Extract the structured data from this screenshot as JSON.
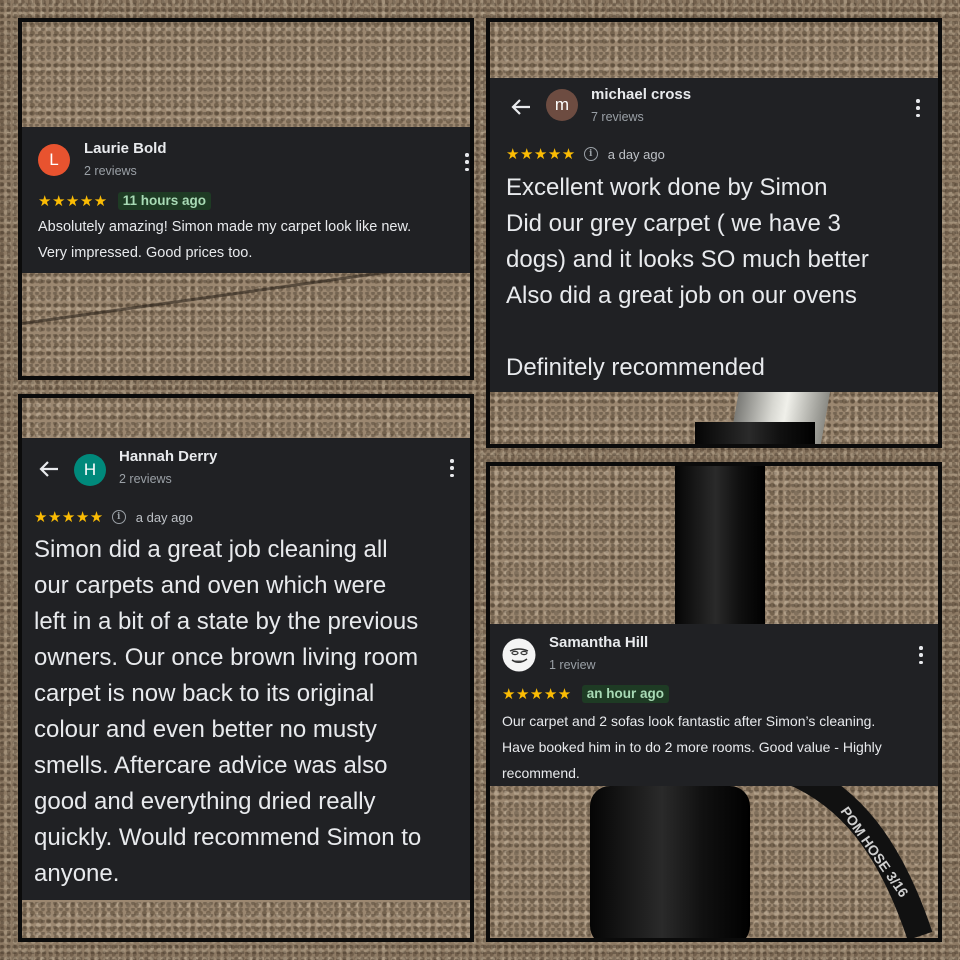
{
  "reviews": {
    "laurie": {
      "avatar_letter": "L",
      "avatar_color": "#e8532f",
      "name": "Laurie Bold",
      "review_count": "2 reviews",
      "stars": "★★★★★",
      "time": "11 hours ago",
      "text": "Absolutely amazing! Simon made my carpet look like new.\nVery impressed.  Good prices too."
    },
    "michael": {
      "avatar_letter": "m",
      "avatar_color": "#6d4c41",
      "name": "michael cross",
      "review_count": "7 reviews",
      "stars": "★★★★★",
      "time": "a day ago",
      "text": "Excellent work done by Simon\nDid our grey carpet ( we have 3\ndogs) and it looks SO much better\nAlso did a great job on our ovens\n\nDefinitely recommended"
    },
    "hannah": {
      "avatar_letter": "H",
      "avatar_color": "#00897b",
      "name": "Hannah Derry",
      "review_count": "2 reviews",
      "stars": "★★★★★",
      "time": "a day ago",
      "text": "Simon did a great job cleaning all\nour carpets and oven which were\nleft in a bit of a state by the previous\nowners. Our once brown living room\ncarpet is now back to its original\ncolour and even better no musty\nsmells. Aftercare advice was also\ngood and everything dried really\nquickly. Would recommend Simon to\nanyone."
    },
    "samantha": {
      "name": "Samantha Hill",
      "review_count": "1 review",
      "stars": "★★★★★",
      "time": "an hour ago",
      "text": "Our carpet and 2 sofas look fantastic after Simon’s cleaning.\nHave booked him in to do 2 more rooms. Good value - Highly\nrecommend."
    }
  },
  "icons": {
    "back": "back-arrow-icon",
    "menu": "more-vert-icon",
    "info": "info-icon",
    "stars": "star-icon"
  },
  "colors": {
    "card_bg": "#202124",
    "star": "#fbbc04",
    "badge_bg": "#1e3b24",
    "badge_text": "#a8dab5"
  },
  "photo": {
    "hose_label": "POM HOSE 3/16"
  }
}
